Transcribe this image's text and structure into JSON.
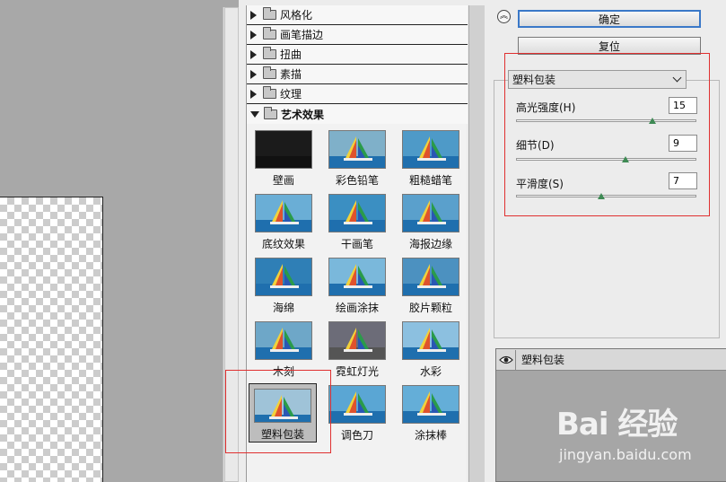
{
  "gallery": {
    "categories": [
      {
        "label": "风格化"
      },
      {
        "label": "画笔描边"
      },
      {
        "label": "扭曲"
      },
      {
        "label": "素描"
      },
      {
        "label": "纹理"
      },
      {
        "label": "艺术效果"
      }
    ],
    "thumbnails": [
      {
        "label": "壁画"
      },
      {
        "label": "彩色铅笔"
      },
      {
        "label": "粗糙蜡笔"
      },
      {
        "label": "底纹效果"
      },
      {
        "label": "干画笔"
      },
      {
        "label": "海报边缘"
      },
      {
        "label": "海绵"
      },
      {
        "label": "绘画涂抹"
      },
      {
        "label": "胶片颗粒"
      },
      {
        "label": "木刻"
      },
      {
        "label": "霓虹灯光"
      },
      {
        "label": "水彩"
      },
      {
        "label": "塑料包装",
        "selected": true
      },
      {
        "label": "调色刀"
      },
      {
        "label": "涂抹棒"
      }
    ]
  },
  "settings": {
    "collapse_icon": "chevron-up-icon",
    "ok_label": "确定",
    "reset_label": "复位",
    "filter_selected": "塑料包装",
    "params": [
      {
        "label": "高光强度(H)",
        "value": "15",
        "max": 20
      },
      {
        "label": "细节(D)",
        "value": "9",
        "max": 15
      },
      {
        "label": "平滑度(S)",
        "value": "7",
        "max": 15
      }
    ]
  },
  "layers": {
    "layer_name": "塑料包装",
    "eye_icon": "eye-icon"
  },
  "watermark": {
    "brand": "Bai 经验",
    "url": "jingyan.baidu.com"
  },
  "colors": {
    "highlight_frame": "#e03030",
    "ok_border": "#3a78c8",
    "slider_knob": "#3e8a54"
  }
}
